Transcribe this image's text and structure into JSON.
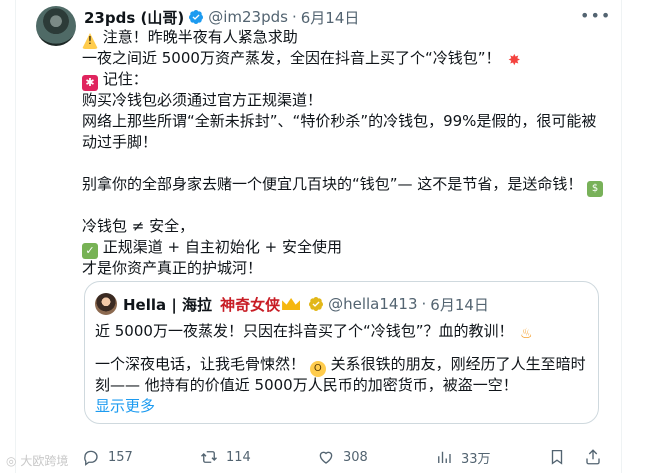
{
  "post": {
    "author_name": "23pds (山哥)",
    "handle": "@im23pds",
    "separator": "·",
    "date": "6月14日",
    "lines": [
      "注意！昨晚半夜有人紧急求助",
      "一夜之间近 5000万资产蒸发，全因在抖音上买了个“冷钱包”！",
      "记住：",
      "购买冷钱包必须通过官方正规渠道！",
      "网络上那些所谓“全新未拆封”、“特价秒杀”的冷钱包，99%是假的，很可能被",
      "动过手脚！",
      "别拿你的全部身家去赌一个便宜几百块的“钱包”— 这不是节省，是送命钱！",
      "冷钱包 ≠ 安全，",
      "正规渠道 + 自主初始化 + 安全使用",
      "才是你资产真正的护城河！"
    ]
  },
  "quote": {
    "author_name": "Hella | 海拉",
    "badge_text": "神奇女侠",
    "handle": "@hella1413",
    "separator": "·",
    "date": "6月14日",
    "lines": [
      "近 5000万一夜蒸发！只因在抖音买了个“冷钱包”？血的教训！",
      "一个深夜电话，让我毛骨悚然！",
      "关系很铁的朋友，刚经历了人生至暗时",
      "刻—— 他持有的价值近 5000万人民币的加密货币，被盗一空！"
    ],
    "show_more": "显示更多"
  },
  "actions": {
    "replies": "157",
    "reposts": "114",
    "likes": "308",
    "views": "33万"
  },
  "watermark": "大欧跨境",
  "colors": {
    "link": "#1d9bf0",
    "muted": "#536471",
    "verified": "#1d9bf0",
    "gold": "#e2b719"
  }
}
